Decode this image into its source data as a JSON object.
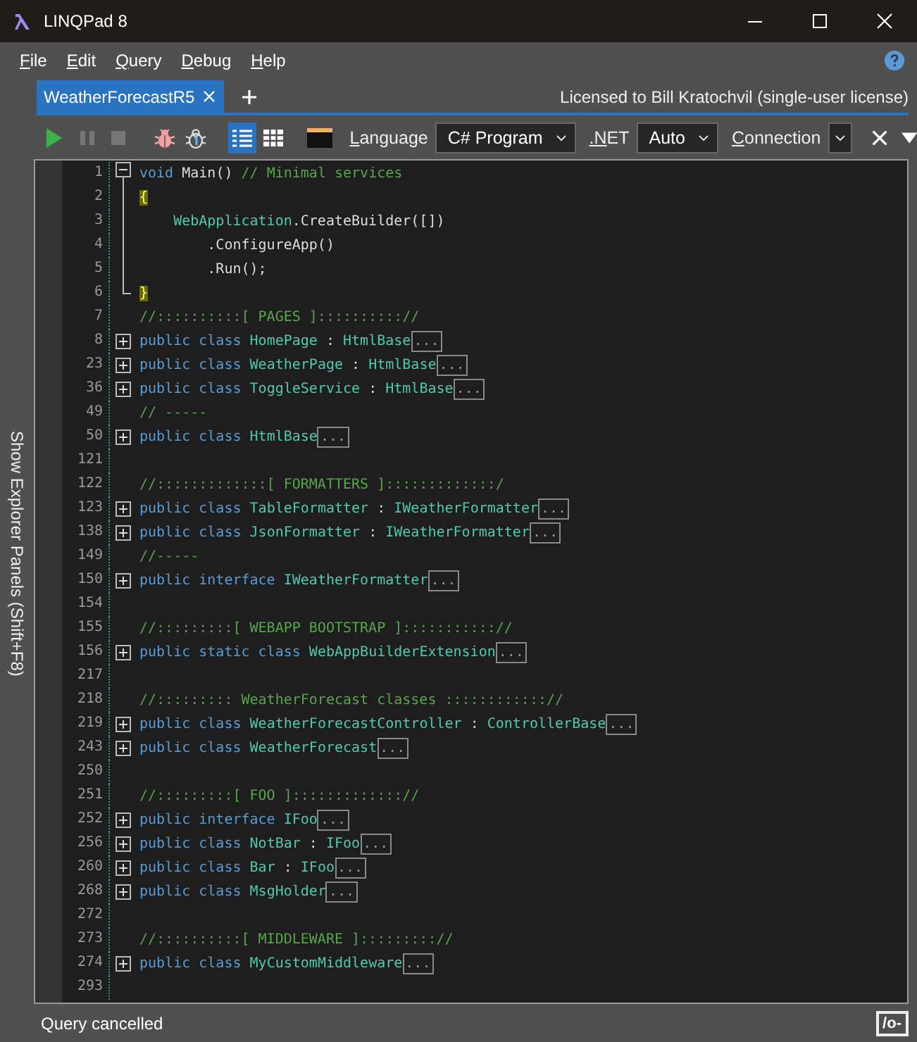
{
  "window": {
    "title": "LINQPad 8"
  },
  "menu": [
    {
      "label": "File"
    },
    {
      "label": "Edit"
    },
    {
      "label": "Query"
    },
    {
      "label": "Debug"
    },
    {
      "label": "Help"
    }
  ],
  "tabs": [
    {
      "label": "WeatherForecastR5",
      "selected": true
    }
  ],
  "license": "Licensed to Bill Kratochvil (single-user license)",
  "toolbar": {
    "buttons": [
      {
        "kind": "run",
        "disabled": false
      },
      {
        "kind": "pause",
        "disabled": true
      },
      {
        "kind": "stop",
        "disabled": true
      },
      {
        "kind": "bug",
        "disabled": false
      },
      {
        "kind": "bug-step",
        "disabled": false
      },
      {
        "kind": "rich-grid",
        "selected": true
      },
      {
        "kind": "data-grid",
        "selected": false
      },
      {
        "kind": "results-panel",
        "selected": false
      }
    ],
    "fields": [
      {
        "label": "Language",
        "value": "C# Program"
      },
      {
        "label": ".NET",
        "value": "Auto"
      },
      {
        "label": "Connection"
      }
    ]
  },
  "side_panel": {
    "label": "Show Explorer Panels  (Shift+F8)"
  },
  "editor": {
    "lines": [
      {
        "number": "1",
        "kind": "expanded",
        "segments": [
          {
            "kind": "kw",
            "text": "void"
          },
          {
            "kind": "plain",
            "text": " Main() "
          },
          {
            "kind": "comment",
            "text": "// Minimal services"
          }
        ]
      },
      {
        "number": "2",
        "kind": "guide",
        "segments": [
          {
            "kind": "match",
            "text": "{"
          }
        ]
      },
      {
        "number": "3",
        "kind": "guide",
        "segments": [
          {
            "kind": "type",
            "text": "    WebApplication"
          },
          {
            "kind": "plain",
            "text": ".CreateBuilder([])"
          }
        ]
      },
      {
        "number": "4",
        "kind": "guide",
        "segments": [
          {
            "kind": "plain",
            "text": "        .ConfigureApp()"
          }
        ]
      },
      {
        "number": "5",
        "kind": "guide",
        "segments": [
          {
            "kind": "plain",
            "text": "        .Run();"
          }
        ]
      },
      {
        "number": "6",
        "kind": "end",
        "segments": [
          {
            "kind": "match",
            "text": "}"
          }
        ]
      },
      {
        "number": "7",
        "kind": "plain",
        "segments": [
          {
            "kind": "comment",
            "text": "//::::::::::[ PAGES ]:::::::::://"
          }
        ]
      },
      {
        "number": "8",
        "kind": "collapsed",
        "marker": "...",
        "segments": [
          {
            "kind": "kw",
            "text": "public class "
          },
          {
            "kind": "type",
            "text": "HomePage"
          },
          {
            "kind": "plain",
            "text": " : "
          },
          {
            "kind": "type",
            "text": "HtmlBase"
          }
        ]
      },
      {
        "number": "23",
        "kind": "collapsed",
        "marker": "...",
        "segments": [
          {
            "kind": "kw",
            "text": "public class "
          },
          {
            "kind": "type",
            "text": "WeatherPage"
          },
          {
            "kind": "plain",
            "text": " : "
          },
          {
            "kind": "type",
            "text": "HtmlBase"
          }
        ]
      },
      {
        "number": "36",
        "kind": "collapsed",
        "marker": "...",
        "segments": [
          {
            "kind": "kw",
            "text": "public class "
          },
          {
            "kind": "type",
            "text": "ToggleService"
          },
          {
            "kind": "plain",
            "text": " : "
          },
          {
            "kind": "type",
            "text": "HtmlBase"
          }
        ]
      },
      {
        "number": "49",
        "kind": "plain",
        "segments": [
          {
            "kind": "comment",
            "text": "// -----"
          }
        ]
      },
      {
        "number": "50",
        "kind": "collapsed",
        "marker": "...",
        "segments": [
          {
            "kind": "kw",
            "text": "public class "
          },
          {
            "kind": "type",
            "text": "HtmlBase"
          }
        ]
      },
      {
        "number": "121",
        "kind": "plain"
      },
      {
        "number": "122",
        "kind": "plain",
        "segments": [
          {
            "kind": "comment",
            "text": "//:::::::::::::[ FORMATTERS ]:::::::::::::/"
          }
        ]
      },
      {
        "number": "123",
        "kind": "collapsed",
        "marker": "...",
        "segments": [
          {
            "kind": "kw",
            "text": "public class "
          },
          {
            "kind": "type",
            "text": "TableFormatter"
          },
          {
            "kind": "plain",
            "text": " : "
          },
          {
            "kind": "type",
            "text": "IWeatherFormatter"
          }
        ]
      },
      {
        "number": "138",
        "kind": "collapsed",
        "marker": "...",
        "segments": [
          {
            "kind": "kw",
            "text": "public class "
          },
          {
            "kind": "type",
            "text": "JsonFormatter"
          },
          {
            "kind": "plain",
            "text": " : "
          },
          {
            "kind": "type",
            "text": "IWeatherFormatter"
          }
        ]
      },
      {
        "number": "149",
        "kind": "plain",
        "segments": [
          {
            "kind": "comment",
            "text": "//-----"
          }
        ]
      },
      {
        "number": "150",
        "kind": "collapsed",
        "marker": "...",
        "segments": [
          {
            "kind": "kw",
            "text": "public interface "
          },
          {
            "kind": "type",
            "text": "IWeatherFormatter"
          }
        ]
      },
      {
        "number": "154",
        "kind": "plain"
      },
      {
        "number": "155",
        "kind": "plain",
        "segments": [
          {
            "kind": "comment",
            "text": "//:::::::::[ WEBAPP BOOTSTRAP ]::::::::::://"
          }
        ]
      },
      {
        "number": "156",
        "kind": "collapsed",
        "marker": "...",
        "segments": [
          {
            "kind": "kw",
            "text": "public static class "
          },
          {
            "kind": "type",
            "text": "WebAppBuilderExtension"
          }
        ]
      },
      {
        "number": "217",
        "kind": "plain"
      },
      {
        "number": "218",
        "kind": "plain",
        "segments": [
          {
            "kind": "comment",
            "text": "//::::::::: WeatherForecast classes :::::::::::://"
          }
        ]
      },
      {
        "number": "219",
        "kind": "collapsed",
        "marker": "...",
        "segments": [
          {
            "kind": "kw",
            "text": "public class "
          },
          {
            "kind": "type",
            "text": "WeatherForecastController"
          },
          {
            "kind": "plain",
            "text": " : "
          },
          {
            "kind": "type",
            "text": "ControllerBase"
          }
        ]
      },
      {
        "number": "243",
        "kind": "collapsed",
        "marker": "...",
        "segments": [
          {
            "kind": "kw",
            "text": "public class "
          },
          {
            "kind": "type",
            "text": "WeatherForecast"
          }
        ]
      },
      {
        "number": "250",
        "kind": "plain"
      },
      {
        "number": "251",
        "kind": "plain",
        "segments": [
          {
            "kind": "comment",
            "text": "//:::::::::[ FOO ]::::::::::::://"
          }
        ]
      },
      {
        "number": "252",
        "kind": "collapsed",
        "marker": "...",
        "segments": [
          {
            "kind": "kw",
            "text": "public interface "
          },
          {
            "kind": "type",
            "text": "IFoo"
          }
        ]
      },
      {
        "number": "256",
        "kind": "collapsed",
        "marker": "...",
        "segments": [
          {
            "kind": "kw",
            "text": "public class "
          },
          {
            "kind": "type",
            "text": "NotBar"
          },
          {
            "kind": "plain",
            "text": " : "
          },
          {
            "kind": "type",
            "text": "IFoo"
          }
        ]
      },
      {
        "number": "260",
        "kind": "collapsed",
        "marker": "...",
        "segments": [
          {
            "kind": "kw",
            "text": "public class "
          },
          {
            "kind": "type",
            "text": "Bar"
          },
          {
            "kind": "plain",
            "text": " : "
          },
          {
            "kind": "type",
            "text": "IFoo"
          }
        ]
      },
      {
        "number": "268",
        "kind": "collapsed",
        "marker": "...",
        "segments": [
          {
            "kind": "kw",
            "text": "public class "
          },
          {
            "kind": "type",
            "text": "MsgHolder"
          }
        ]
      },
      {
        "number": "272",
        "kind": "plain"
      },
      {
        "number": "273",
        "kind": "plain",
        "segments": [
          {
            "kind": "comment",
            "text": "//::::::::::[ MIDDLEWARE ]::::::::://"
          }
        ]
      },
      {
        "number": "274",
        "kind": "collapsed",
        "marker": "...",
        "segments": [
          {
            "kind": "kw",
            "text": "public class "
          },
          {
            "kind": "type",
            "text": "MyCustomMiddleware"
          }
        ]
      },
      {
        "number": "293",
        "kind": "plain"
      }
    ]
  },
  "status_bar": {
    "text": "Query cancelled",
    "button": "/o-"
  }
}
